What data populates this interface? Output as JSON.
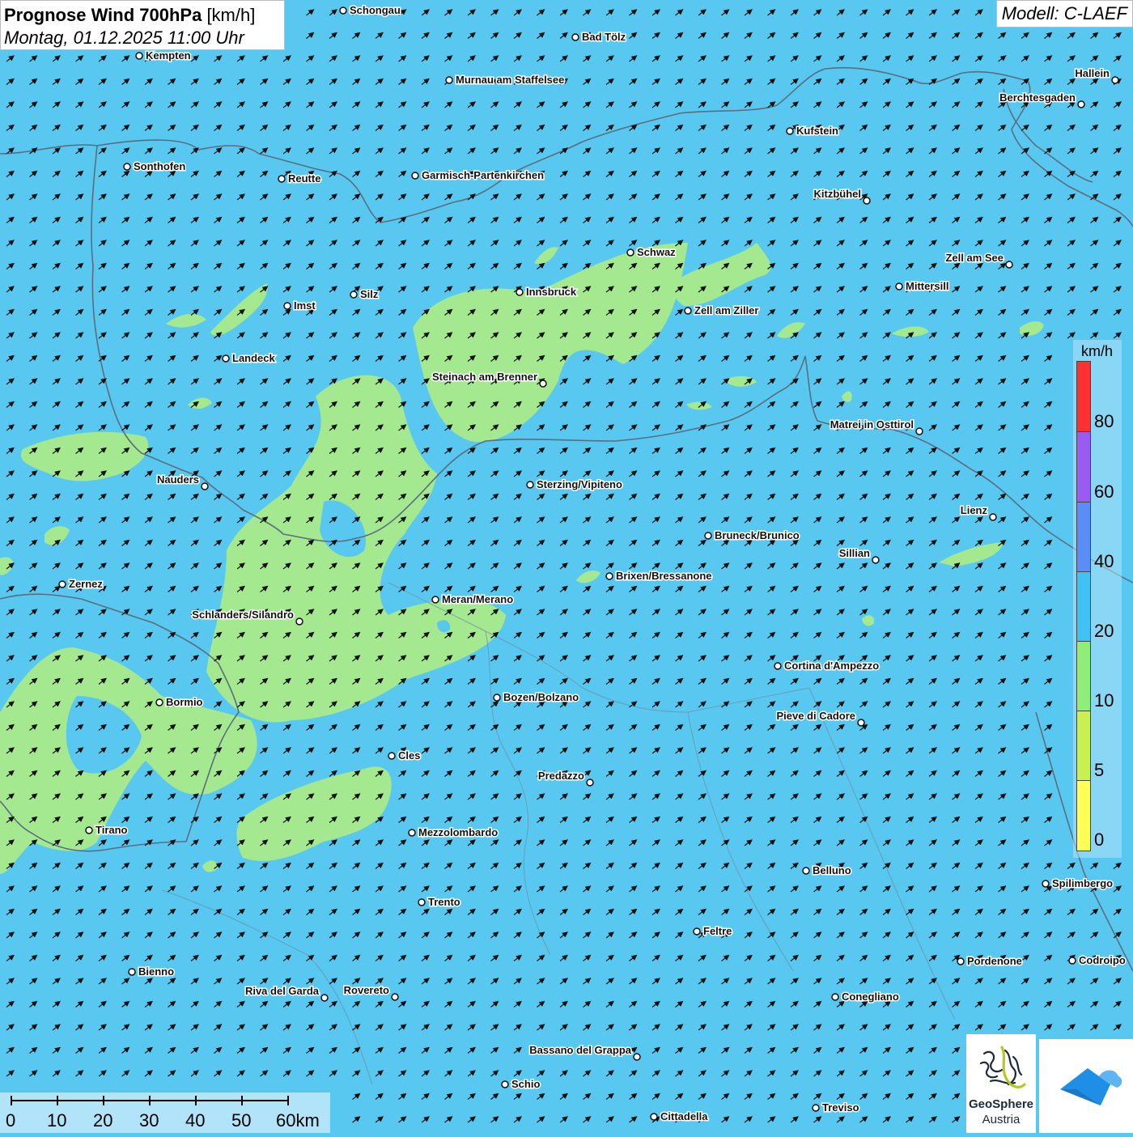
{
  "header": {
    "title": "Prognose Wind 700hPa",
    "unit": "[km/h]",
    "datetime": "Montag, 01.12.2025 11:00 Uhr",
    "model": "Modell: C-LAEF"
  },
  "legend": {
    "unit": "km/h",
    "labels": [
      "80",
      "60",
      "40",
      "20",
      "10",
      "5",
      "0"
    ],
    "colors": [
      "#ff3030",
      "#9a5cf0",
      "#5c8cf5",
      "#40c2f5",
      "#90ee78",
      "#c8f050",
      "#ffff55"
    ]
  },
  "scale_bar": {
    "labels": [
      "0",
      "10",
      "20",
      "30",
      "40",
      "50",
      "60km"
    ]
  },
  "logos": {
    "geosphere_line1": "GeoSphere",
    "geosphere_line2": "Austria"
  },
  "map": {
    "background_color": "#58c8f0",
    "wind_zone_color": "#a4e890",
    "arrow_direction": "northeast",
    "cities": [
      {
        "name": "Schongau",
        "label_side": "right"
      },
      {
        "name": "Bad Tölz",
        "label_side": "right"
      },
      {
        "name": "Kempten",
        "label_side": "right"
      },
      {
        "name": "Murnau am Staffelsee",
        "label_side": "right"
      },
      {
        "name": "Hallein",
        "label_side": "left"
      },
      {
        "name": "Berchtesgaden",
        "label_side": "left"
      },
      {
        "name": "Kufstein",
        "label_side": "right"
      },
      {
        "name": "Sonthofen",
        "label_side": "right"
      },
      {
        "name": "Reutte",
        "label_side": "right"
      },
      {
        "name": "Garmisch-Partenkirchen",
        "label_side": "right"
      },
      {
        "name": "Kitzbühel",
        "label_side": "left"
      },
      {
        "name": "Schwaz",
        "label_side": "right"
      },
      {
        "name": "Zell am See",
        "label_side": "left"
      },
      {
        "name": "Mittersill",
        "label_side": "right"
      },
      {
        "name": "Innsbruck",
        "label_side": "right"
      },
      {
        "name": "Zell am Ziller",
        "label_side": "right"
      },
      {
        "name": "Imst",
        "label_side": "right"
      },
      {
        "name": "Silz",
        "label_side": "right"
      },
      {
        "name": "Landeck",
        "label_side": "right"
      },
      {
        "name": "Steinach am Brenner",
        "label_side": "left"
      },
      {
        "name": "Matrei in Osttirol",
        "label_side": "left"
      },
      {
        "name": "Nauders",
        "label_side": "left"
      },
      {
        "name": "Sterzing/Vipiteno",
        "label_side": "right"
      },
      {
        "name": "Lienz",
        "label_side": "left"
      },
      {
        "name": "Bruneck/Brunico",
        "label_side": "right"
      },
      {
        "name": "Sillian",
        "label_side": "left"
      },
      {
        "name": "Zernez",
        "label_side": "right"
      },
      {
        "name": "Brixen/Bressanone",
        "label_side": "right"
      },
      {
        "name": "Meran/Merano",
        "label_side": "right"
      },
      {
        "name": "Schlanders/Silandro",
        "label_side": "left"
      },
      {
        "name": "Cortina d'Ampezzo",
        "label_side": "right"
      },
      {
        "name": "Bozen/Bolzano",
        "label_side": "right"
      },
      {
        "name": "Bormio",
        "label_side": "right"
      },
      {
        "name": "Pieve di Cadore",
        "label_side": "left"
      },
      {
        "name": "Cles",
        "label_side": "right"
      },
      {
        "name": "Predazzo",
        "label_side": "left"
      },
      {
        "name": "Tirano",
        "label_side": "right"
      },
      {
        "name": "Mezzolombardo",
        "label_side": "right"
      },
      {
        "name": "Belluno",
        "label_side": "right"
      },
      {
        "name": "Spilimbergo",
        "label_side": "right"
      },
      {
        "name": "Trento",
        "label_side": "right"
      },
      {
        "name": "Feltre",
        "label_side": "right"
      },
      {
        "name": "Bienno",
        "label_side": "right"
      },
      {
        "name": "Pordenone",
        "label_side": "right"
      },
      {
        "name": "Codroipo",
        "label_side": "right"
      },
      {
        "name": "Riva del Garda",
        "label_side": "left"
      },
      {
        "name": "Rovereto",
        "label_side": "left"
      },
      {
        "name": "Conegliano",
        "label_side": "right"
      },
      {
        "name": "Bassano del Grappa",
        "label_side": "left"
      },
      {
        "name": "Schio",
        "label_side": "right"
      },
      {
        "name": "Treviso",
        "label_side": "right"
      },
      {
        "name": "Cittadella",
        "label_side": "right"
      }
    ]
  }
}
